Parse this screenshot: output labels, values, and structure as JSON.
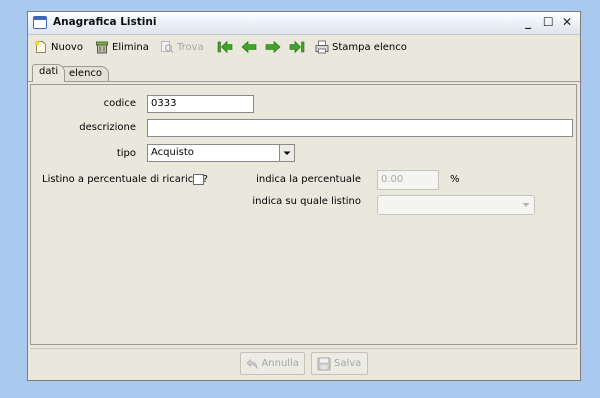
{
  "window": {
    "title": "Anagrafica Listini",
    "controls": {
      "minimize": "_",
      "maximize": "☐",
      "close": "✕"
    }
  },
  "toolbar": {
    "new_label": "Nuovo",
    "delete_label": "Elimina",
    "find_label": "Trova",
    "print_label": "Stampa elenco",
    "icons": [
      "new-doc-icon",
      "trash-icon",
      "find-icon",
      "first-arrow-icon",
      "prev-arrow-icon",
      "next-arrow-icon",
      "last-arrow-icon",
      "print-icon"
    ]
  },
  "tabs": [
    {
      "label": "dati",
      "active": true
    },
    {
      "label": "elenco",
      "active": false
    }
  ],
  "form": {
    "codice_label": "codice",
    "codice_value": "0333",
    "descrizione_label": "descrizione",
    "descrizione_value": "",
    "tipo_label": "tipo",
    "tipo_value": "Acquisto",
    "ricarico_label": "Listino a percentuale di ricarico ?",
    "ricarico_checked": false,
    "percentuale_label": "indica la percentuale",
    "percentuale_value": "0.00",
    "percent_unit": "%",
    "listino_label": "indica su quale listino",
    "listino_value": ""
  },
  "footer": {
    "cancel_label": "Annulla",
    "save_label": "Salva"
  },
  "colors": {
    "desktop": "#a9c9ee",
    "window_bg": "#eae8dd",
    "arrow_green": "#3fa526"
  }
}
